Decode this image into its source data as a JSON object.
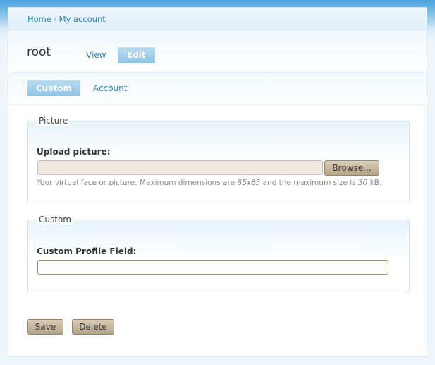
{
  "breadcrumb": {
    "home": "Home",
    "separator": "›",
    "my_account": "My account"
  },
  "header": {
    "title": "root",
    "tabs": [
      {
        "label": "View",
        "active": false
      },
      {
        "label": "Edit",
        "active": true
      }
    ]
  },
  "subtabs": [
    {
      "label": "Custom",
      "active": true
    },
    {
      "label": "Account",
      "active": false
    }
  ],
  "picture_fieldset": {
    "legend": "Picture",
    "upload_label": "Upload picture:",
    "file_value": "",
    "browse_label": "Browse...",
    "help_prefix": "Your virtual face or picture. Maximum dimensions are ",
    "help_dims": "85x85",
    "help_middle": " and the maximum size is ",
    "help_size": "30",
    "help_suffix": " kB."
  },
  "custom_fieldset": {
    "legend": "Custom",
    "field_label": "Custom Profile Field:",
    "field_value": ""
  },
  "actions": {
    "save_label": "Save",
    "delete_label": "Delete"
  }
}
